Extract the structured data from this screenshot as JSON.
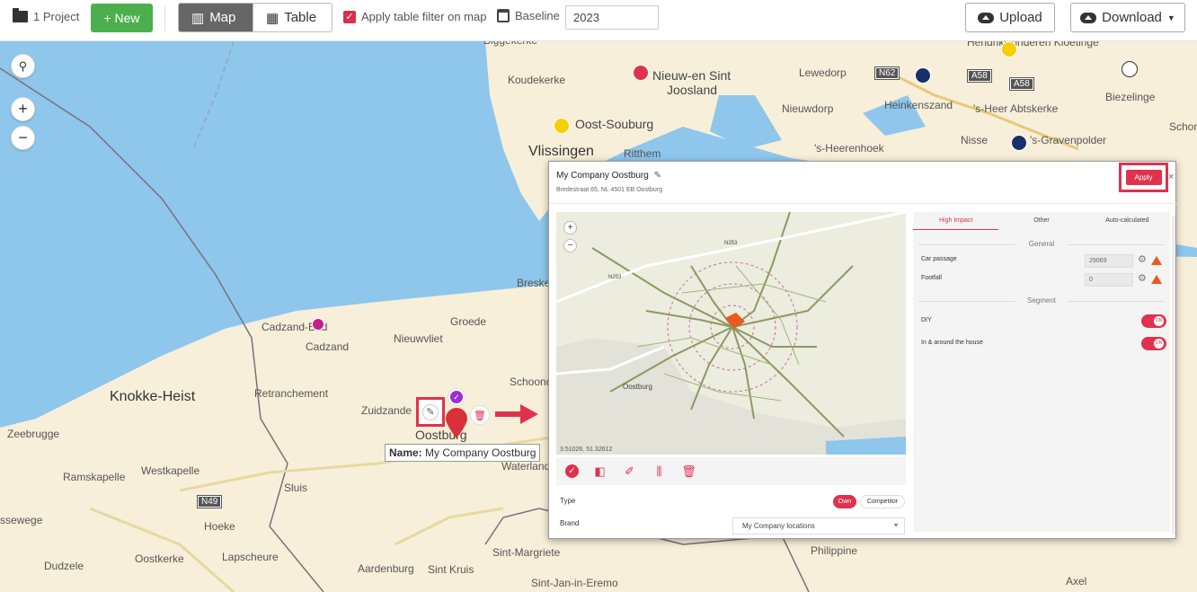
{
  "toolbar": {
    "project_label": "1 Project",
    "new_label": "+ New",
    "map_label": "Map",
    "table_label": "Table",
    "filter_label": "Apply table filter on map",
    "baseline_label": "Baseline",
    "baseline_value": "2023",
    "upload_label": "Upload",
    "download_label": "Download"
  },
  "map": {
    "places": [
      "Biggekerke",
      "Koudekerke",
      "Nieuw-en Sint",
      "Joosland",
      "Oost-Souburg",
      "Vlissingen",
      "Ritthem",
      "Nieuwdorp",
      "'s-Heerenhoek",
      "Lewedorp",
      "Heinkenszand",
      "'s-Heer Abtskerke",
      "Nisse",
      "'s-Gravenpolder",
      "Biezelinge",
      "Hendrikskinderen Kloetinge",
      "Schore",
      "Breskens",
      "Groede",
      "Cadzand-Bad",
      "Cadzand",
      "Nieuwvliet",
      "Knokke-Heist",
      "Retranchement",
      "Schoondijke",
      "Zuidzande",
      "Oostburg",
      "Waterland",
      "Zeebrugge",
      "Ramskapelle",
      "Westkapelle",
      "Sluis",
      "Hoeke",
      "Lapscheure",
      "Oostkerke",
      "Dudzele",
      "Aardenburg",
      "Sint Kruis",
      "Sint-Margriete",
      "Sint-Jan-in-Eremo",
      "Philippine",
      "Axel",
      "ssewege"
    ],
    "roads": [
      "N62",
      "A58",
      "A58",
      "N253",
      "N49"
    ],
    "tooltip_name_key": "Name:",
    "tooltip_name_value": "My Company Oostburg"
  },
  "modal": {
    "title": "My Company Oostburg",
    "address": "Bredestraat 65, NL 4501 EB Oostburg",
    "apply_label": "Apply",
    "close_label": "×",
    "mini_map": {
      "labels": [
        "Oostburg",
        "N253",
        "N253"
      ],
      "coords": "3.51026, 51.32612"
    },
    "type_label": "Type",
    "type_own": "Own",
    "type_competitor": "Competitor",
    "brand_label": "Brand",
    "brand_value": "My Company locations",
    "tabs": [
      "High Impact",
      "Other",
      "Auto-calculated"
    ],
    "section_general": "General",
    "car_passage_label": "Car passage",
    "car_passage_value": "29069",
    "footfall_label": "Footfall",
    "footfall_value": "0",
    "section_segment": "Segment",
    "diy_label": "DIY",
    "diy_toggle": "ON",
    "house_label": "In & around the house",
    "house_toggle": "ON"
  },
  "colors": {
    "accent": "#e0324c",
    "new_button": "#4cae4c",
    "water": "#8ec6ec",
    "land": "#f7efd9"
  }
}
